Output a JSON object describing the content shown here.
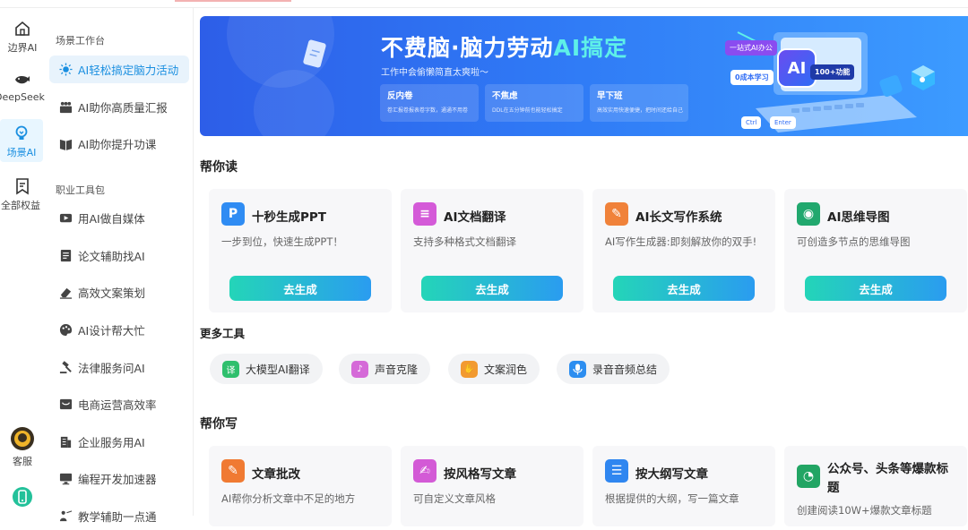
{
  "rail": [
    {
      "label": "边界AI",
      "icon": "home-icon"
    },
    {
      "label": "DeepSeek",
      "icon": "whale-icon"
    },
    {
      "label": "场景AI",
      "icon": "bulb-icon",
      "active": true
    },
    {
      "label": "全部权益",
      "icon": "bookmark-icon"
    },
    {
      "label": "客服",
      "icon": "support-avatar-icon"
    },
    {
      "label": "",
      "icon": "phone-icon"
    }
  ],
  "sidebar": {
    "section1": "场景工作台",
    "items1": [
      {
        "label": "AI轻松搞定脑力活动",
        "icon": "sun-icon",
        "active": true
      },
      {
        "label": "AI助你高质量汇报",
        "icon": "people-icon"
      },
      {
        "label": "AI助你提升功课",
        "icon": "book-icon"
      }
    ],
    "section2": "职业工具包",
    "items2": [
      {
        "label": "用AI做自媒体",
        "icon": "video-icon"
      },
      {
        "label": "论文辅助找AI",
        "icon": "document-icon"
      },
      {
        "label": "高效文案策划",
        "icon": "eraser-icon"
      },
      {
        "label": "AI设计帮大忙",
        "icon": "palette-icon"
      },
      {
        "label": "法律服务问AI",
        "icon": "gavel-icon"
      },
      {
        "label": "电商运营高效率",
        "icon": "shop-icon"
      },
      {
        "label": "企业服务用AI",
        "icon": "building-icon"
      },
      {
        "label": "编程开发加速器",
        "icon": "monitor-icon"
      },
      {
        "label": "教学辅助一点通",
        "icon": "teacher-icon"
      }
    ]
  },
  "banner": {
    "title_pre": "不费脑·脑力劳动",
    "title_ai": "AI搞定",
    "subtitle": "工作中会偷懒简直太爽啦～",
    "cards": [
      {
        "title": "反内卷",
        "desc": "卷汇报卷报表卷字数，通通不用卷"
      },
      {
        "title": "不焦虑",
        "desc": "DDL在五分钟前也能轻松搞定"
      },
      {
        "title": "早下班",
        "desc": "高效实用快速便捷，把时间还给自己"
      }
    ],
    "chips": {
      "one_stop": "一站式AI办公",
      "zero_cost": "0成本学习",
      "features": "100+功能",
      "ai_badge": "AI",
      "ctrl": "Ctrl",
      "enter": "Enter"
    }
  },
  "read": {
    "header": "帮你读",
    "cards": [
      {
        "title": "十秒生成PPT",
        "desc": "一步到位，快速生成PPT！",
        "button": "去生成",
        "icon": "ppt-icon",
        "color": "#2f8cf3",
        "glyph": "P"
      },
      {
        "title": "AI文档翻译",
        "desc": "支持多种格式文档翻译",
        "button": "去生成",
        "icon": "translate-doc-icon",
        "color": "#d45ad8",
        "glyph": "≡"
      },
      {
        "title": "AI长文写作系统",
        "desc": "AI写作生成器:即刻解放你的双手!",
        "button": "去生成",
        "icon": "brush-icon",
        "color": "#f0823a",
        "glyph": "✎"
      },
      {
        "title": "AI思维导图",
        "desc": "可创造多节点的思维导图",
        "button": "去生成",
        "icon": "mindmap-icon",
        "color": "#21a86e",
        "glyph": "◉"
      }
    ]
  },
  "more": {
    "header": "更多工具",
    "tools": [
      {
        "label": "大模型AI翻译",
        "icon": "translate-icon",
        "color": "#2fbf6d",
        "glyph": "译"
      },
      {
        "label": "声音克隆",
        "icon": "voice-clone-icon",
        "color": "#d56ad8",
        "glyph": "♪"
      },
      {
        "label": "文案润色",
        "icon": "hand-icon",
        "color": "#f29a30",
        "glyph": "✋"
      },
      {
        "label": "录音音频总结",
        "icon": "microphone-icon",
        "color": "#2d8ef0",
        "glyph": "🎙"
      }
    ]
  },
  "write": {
    "header": "帮你写",
    "cards": [
      {
        "title": "文章批改",
        "desc": "AI帮你分析文章中不足的地方",
        "icon": "edit-icon",
        "color": "#f07a32",
        "glyph": "✎"
      },
      {
        "title": "按风格写文章",
        "desc": "可自定义文章风格",
        "icon": "style-write-icon",
        "color": "#d35ad6",
        "glyph": "✍"
      },
      {
        "title": "按大纲写文章",
        "desc": "根据提供的大纲，写一篇文章",
        "icon": "outline-icon",
        "color": "#2f86f0",
        "glyph": "☰"
      },
      {
        "title1": "公众号、头条等爆款标",
        "title2": "题",
        "desc": "创建阅读10W+爆款文章标题",
        "icon": "wechat-icon",
        "color": "#22a564",
        "glyph": "◔"
      }
    ]
  }
}
